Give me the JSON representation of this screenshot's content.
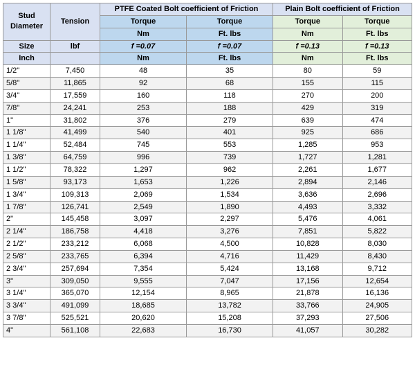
{
  "headers": {
    "studDiameter": "Stud Diameter",
    "tension": "Tension",
    "ptfeGroup": "PTFE Coated Bolt coefficient of Friction",
    "plainGroup": "Plain Bolt coefficient of Friction",
    "size": "Size",
    "ibf": "lbf",
    "torque": "Torque",
    "nm": "Nm",
    "ftlbs": "Ft. lbs",
    "inch": "Inch",
    "ptfeF1": "f =0.07",
    "ptfeF2": "f =0.07",
    "plainF1": "f =0.13",
    "plainF2": "f =0.13"
  },
  "rows": [
    {
      "size": "1/2\"",
      "tension": 7450,
      "ptfe_nm": 48,
      "ptfe_ftlbs": 35,
      "plain_nm": 80,
      "plain_ftlbs": 59
    },
    {
      "size": "5/8\"",
      "tension": 11865,
      "ptfe_nm": 92,
      "ptfe_ftlbs": 68,
      "plain_nm": 155,
      "plain_ftlbs": 115
    },
    {
      "size": "3/4\"",
      "tension": 17559,
      "ptfe_nm": 160,
      "ptfe_ftlbs": 118,
      "plain_nm": 270,
      "plain_ftlbs": 200
    },
    {
      "size": "7/8\"",
      "tension": 24241,
      "ptfe_nm": 253,
      "ptfe_ftlbs": 188,
      "plain_nm": 429,
      "plain_ftlbs": 319
    },
    {
      "size": "1\"",
      "tension": 31802,
      "ptfe_nm": 376,
      "ptfe_ftlbs": 279,
      "plain_nm": 639,
      "plain_ftlbs": 474
    },
    {
      "size": "1  1/8\"",
      "tension": 41499,
      "ptfe_nm": 540,
      "ptfe_ftlbs": 401,
      "plain_nm": 925,
      "plain_ftlbs": 686
    },
    {
      "size": "1  1/4\"",
      "tension": 52484,
      "ptfe_nm": 745,
      "ptfe_ftlbs": 553,
      "plain_nm": 1285,
      "plain_ftlbs": 953
    },
    {
      "size": "1  3/8\"",
      "tension": 64759,
      "ptfe_nm": 996,
      "ptfe_ftlbs": 739,
      "plain_nm": 1727,
      "plain_ftlbs": 1281
    },
    {
      "size": "1  1/2\"",
      "tension": 78322,
      "ptfe_nm": 1297,
      "ptfe_ftlbs": 962,
      "plain_nm": 2261,
      "plain_ftlbs": 1677
    },
    {
      "size": "1  5/8\"",
      "tension": 93173,
      "ptfe_nm": 1653,
      "ptfe_ftlbs": 1226,
      "plain_nm": 2894,
      "plain_ftlbs": 2146
    },
    {
      "size": "1  3/4\"",
      "tension": 109313,
      "ptfe_nm": 2069,
      "ptfe_ftlbs": 1534,
      "plain_nm": 3636,
      "plain_ftlbs": 2696
    },
    {
      "size": "1  7/8\"",
      "tension": 126741,
      "ptfe_nm": 2549,
      "ptfe_ftlbs": 1890,
      "plain_nm": 4493,
      "plain_ftlbs": 3332
    },
    {
      "size": "2\"",
      "tension": 145458,
      "ptfe_nm": 3097,
      "ptfe_ftlbs": 2297,
      "plain_nm": 5476,
      "plain_ftlbs": 4061
    },
    {
      "size": "2  1/4\"",
      "tension": 186758,
      "ptfe_nm": 4418,
      "ptfe_ftlbs": 3276,
      "plain_nm": 7851,
      "plain_ftlbs": 5822
    },
    {
      "size": "2  1/2\"",
      "tension": 233212,
      "ptfe_nm": 6068,
      "ptfe_ftlbs": 4500,
      "plain_nm": 10828,
      "plain_ftlbs": 8030
    },
    {
      "size": "2  5/8\"",
      "tension": 233765,
      "ptfe_nm": 6394,
      "ptfe_ftlbs": 4716,
      "plain_nm": 11429,
      "plain_ftlbs": 8430
    },
    {
      "size": "2  3/4\"",
      "tension": 257694,
      "ptfe_nm": 7354,
      "ptfe_ftlbs": 5424,
      "plain_nm": 13168,
      "plain_ftlbs": 9712
    },
    {
      "size": "3\"",
      "tension": 309050,
      "ptfe_nm": 9555,
      "ptfe_ftlbs": 7047,
      "plain_nm": 17156,
      "plain_ftlbs": 12654
    },
    {
      "size": "3  1/4\"",
      "tension": 365070,
      "ptfe_nm": 12154,
      "ptfe_ftlbs": 8965,
      "plain_nm": 21878,
      "plain_ftlbs": 16136
    },
    {
      "size": "3  3/4\"",
      "tension": 491099,
      "ptfe_nm": 18685,
      "ptfe_ftlbs": 13782,
      "plain_nm": 33766,
      "plain_ftlbs": 24905
    },
    {
      "size": "3  7/8\"",
      "tension": 525521,
      "ptfe_nm": 20620,
      "ptfe_ftlbs": 15208,
      "plain_nm": 37293,
      "plain_ftlbs": 27506
    },
    {
      "size": "4\"",
      "tension": 561108,
      "ptfe_nm": 22683,
      "ptfe_ftlbs": 16730,
      "plain_nm": 41057,
      "plain_ftlbs": 30282
    }
  ]
}
